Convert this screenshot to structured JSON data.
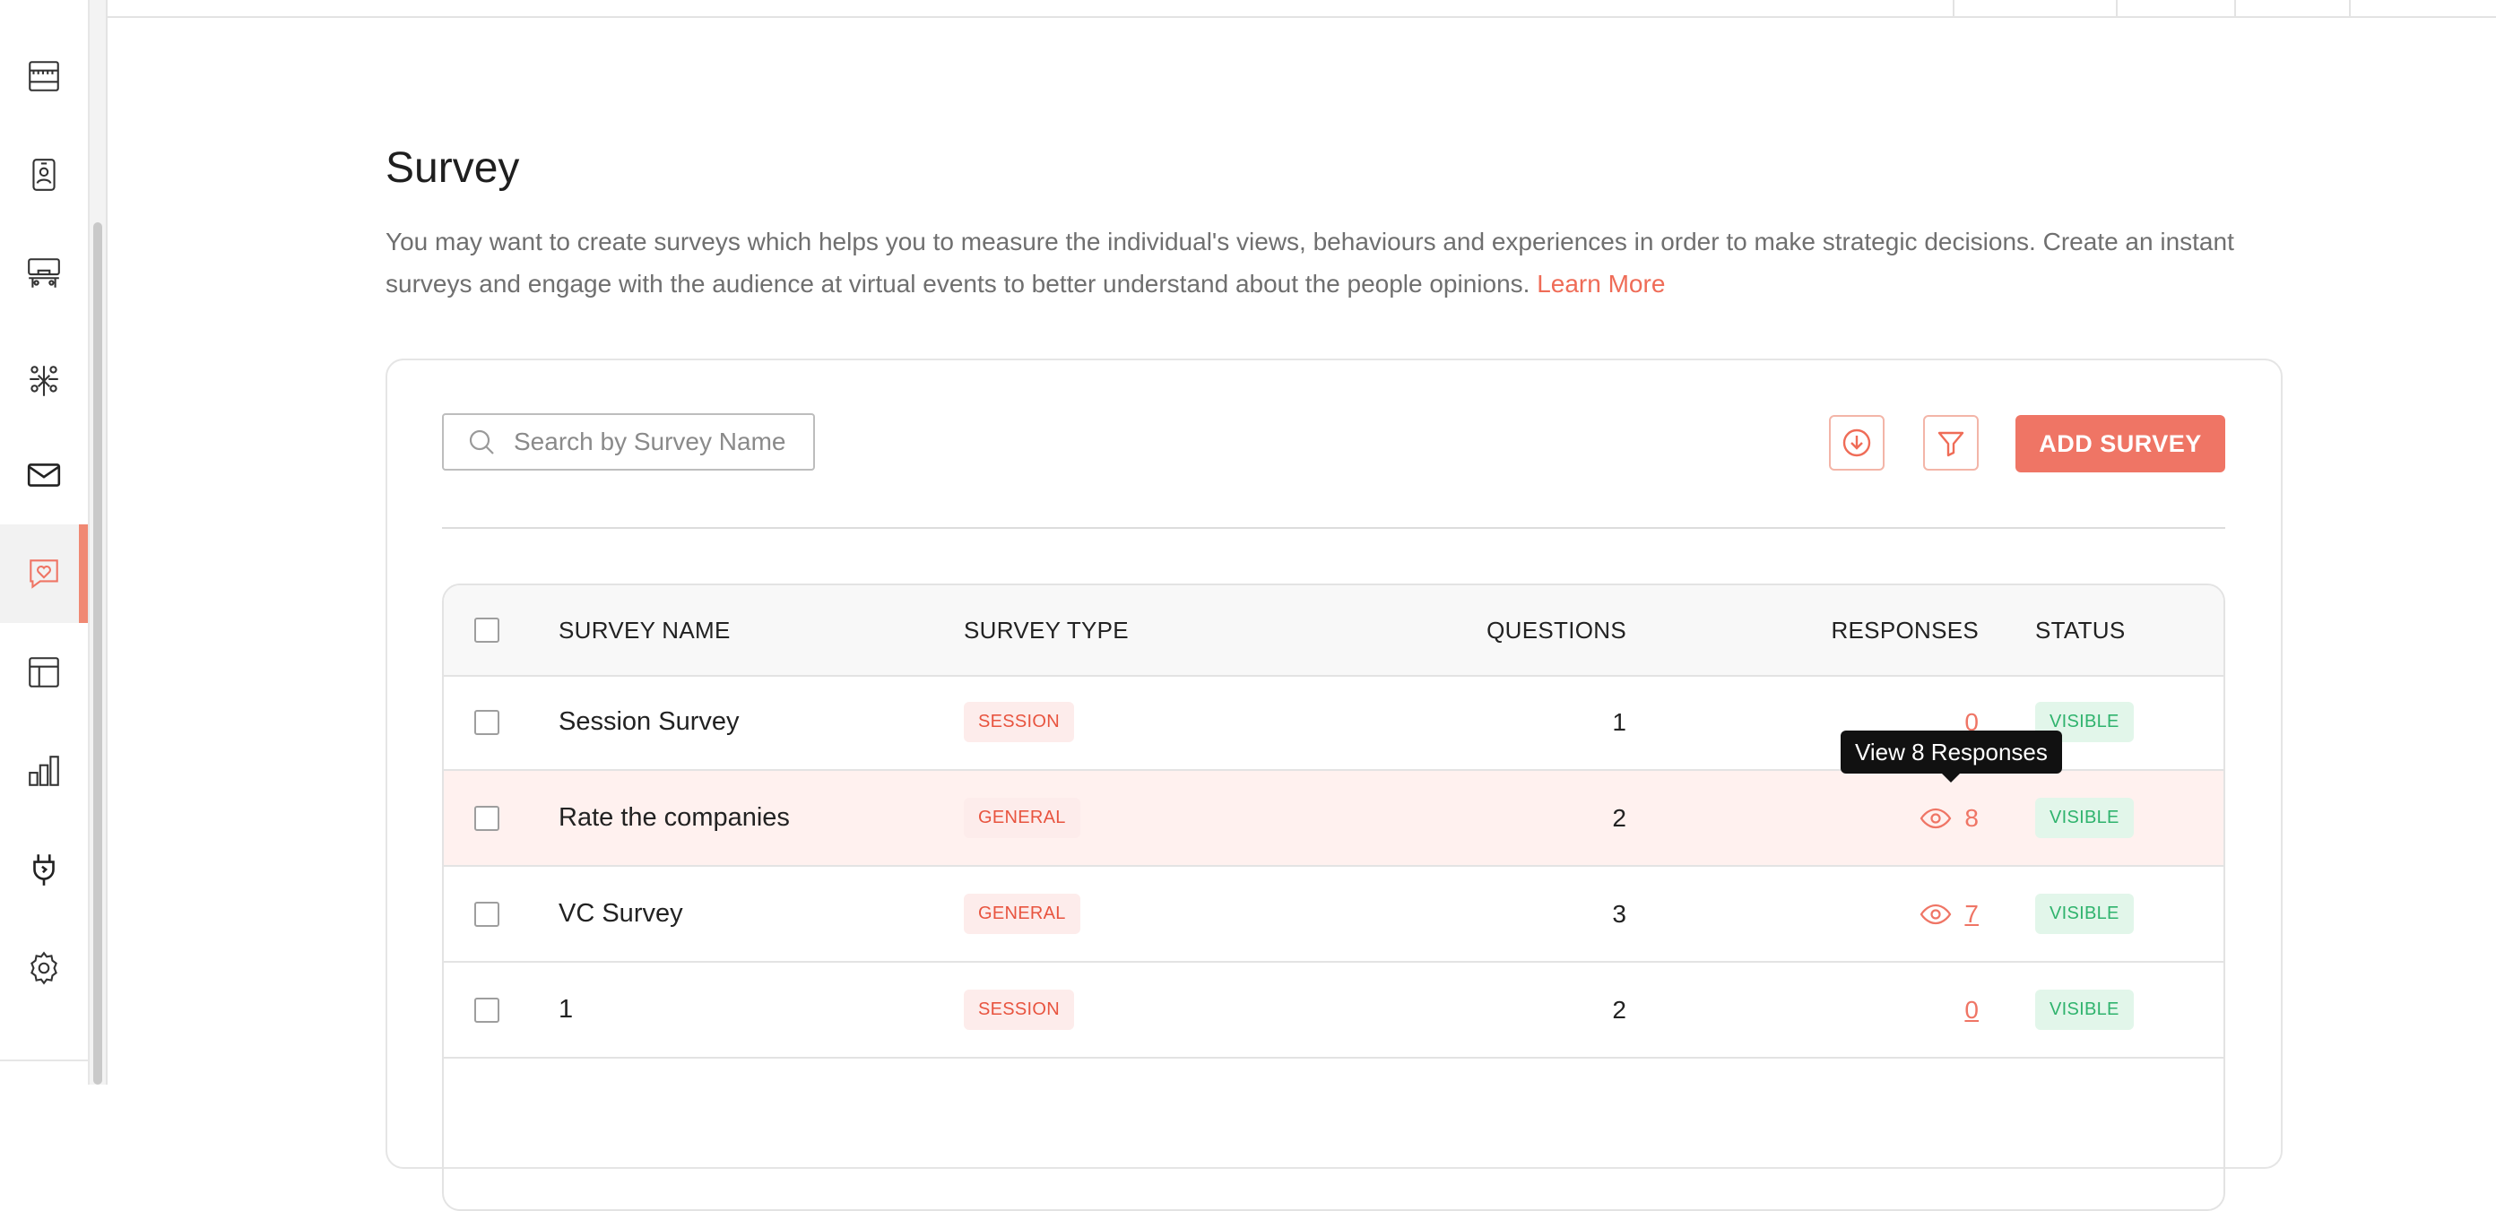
{
  "sidebar": {
    "items": [
      {
        "icon": "storefront-icon"
      },
      {
        "icon": "badge-icon"
      },
      {
        "icon": "lounge-icon"
      },
      {
        "icon": "networking-icon"
      },
      {
        "icon": "mail-icon"
      },
      {
        "icon": "chat-heart-icon",
        "active": true
      },
      {
        "icon": "layout-icon"
      },
      {
        "icon": "analytics-icon"
      },
      {
        "icon": "integrations-plug-icon"
      },
      {
        "icon": "settings-gear-icon"
      }
    ]
  },
  "page": {
    "title": "Survey",
    "description": "You may want to create surveys which helps you to measure the individual's views, behaviours and experiences in order to make strategic decisions. Create an instant surveys and engage with the audience at virtual events to better understand about the people opinions.",
    "learn_more": "Learn More"
  },
  "toolbar": {
    "search_placeholder": "Search by Survey Name",
    "search_value": "",
    "download_icon": "download-circle-icon",
    "filter_icon": "filter-icon",
    "add_label": "ADD SURVEY"
  },
  "table": {
    "headers": {
      "name": "SURVEY NAME",
      "type": "SURVEY TYPE",
      "questions": "QUESTIONS",
      "responses": "RESPONSES",
      "status": "STATUS"
    },
    "rows": [
      {
        "name": "Session Survey",
        "type": "SESSION",
        "questions": "1",
        "responses": "0",
        "status": "VISIBLE"
      },
      {
        "name": "Rate the companies",
        "type": "GENERAL",
        "questions": "2",
        "responses": "8",
        "status": "VISIBLE"
      },
      {
        "name": "VC Survey",
        "type": "GENERAL",
        "questions": "3",
        "responses": "7",
        "status": "VISIBLE"
      },
      {
        "name": "1",
        "type": "SESSION",
        "questions": "2",
        "responses": "0",
        "status": "VISIBLE"
      }
    ]
  },
  "tooltip": {
    "text": "View 8 Responses"
  },
  "colors": {
    "accent": "#ef7565",
    "status_green": "#2fb36d",
    "hover_row": "#fff1ef"
  }
}
